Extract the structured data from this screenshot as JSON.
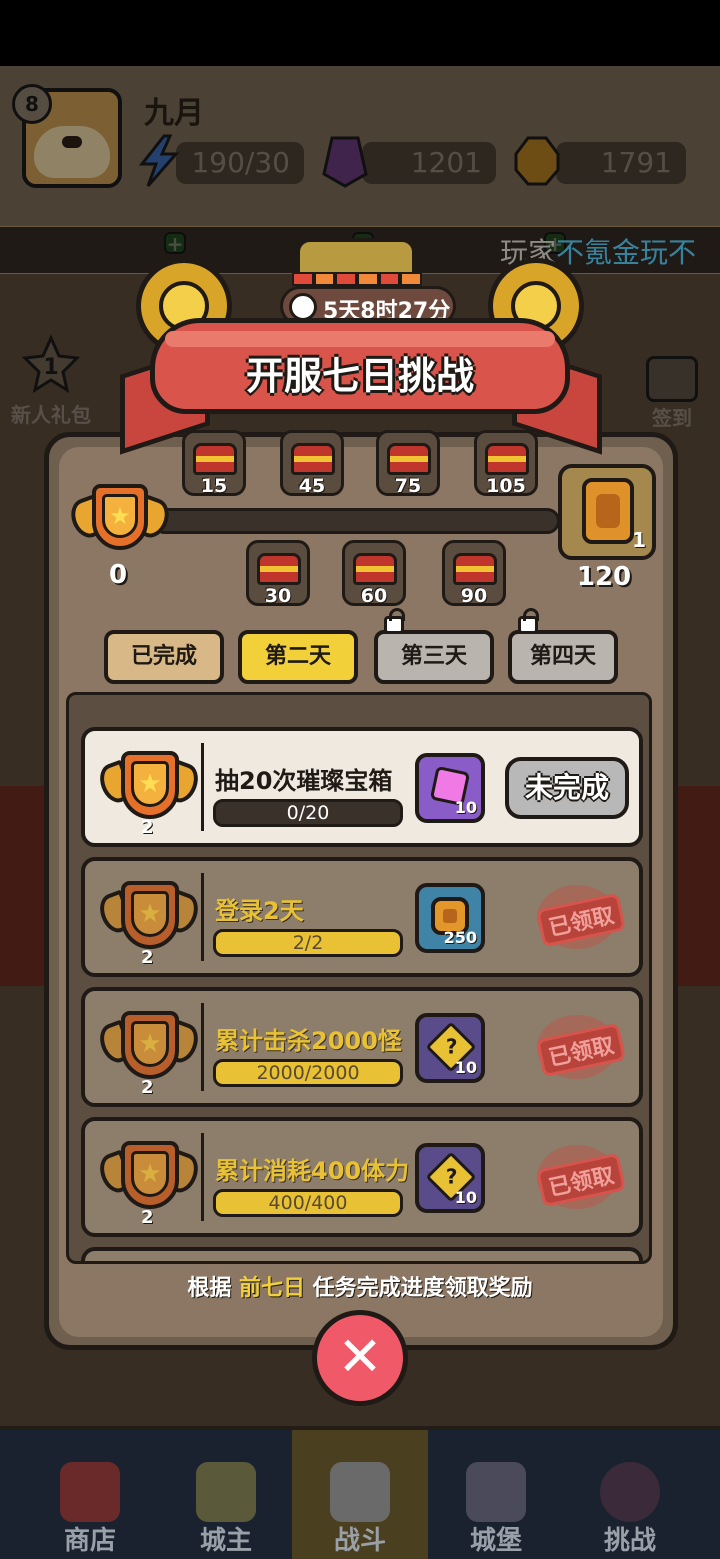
{
  "player": {
    "level": "8",
    "name": "九月"
  },
  "resources": [
    {
      "icon": "lightning-icon",
      "value": "190/30"
    },
    {
      "icon": "purple-gem-icon",
      "value": "1201"
    },
    {
      "icon": "gold-coin-icon",
      "value": "1791"
    }
  ],
  "ticker": {
    "prefix": "玩家",
    "highlight": "不氪金玩不"
  },
  "side_buttons": {
    "newbie_gift": "新人礼包",
    "checkin": "签到"
  },
  "event": {
    "timer": "5天8时27分",
    "title": "开服七日挑战",
    "current_points": "0",
    "progress": 0,
    "milestones_top": [
      "15",
      "45",
      "75",
      "105"
    ],
    "milestones_bottom": [
      "30",
      "60",
      "90"
    ],
    "final_reward": {
      "count": "1",
      "required": "120"
    }
  },
  "tabs": [
    {
      "label": "已完成",
      "state": "done"
    },
    {
      "label": "第二天",
      "state": "active"
    },
    {
      "label": "第三天",
      "state": "locked"
    },
    {
      "label": "第四天",
      "state": "locked"
    }
  ],
  "tasks": [
    {
      "points": "2",
      "title": "抽20次璀璨宝箱",
      "progress": "0/20",
      "progress_fraction": 0,
      "reward_icon": "pink-gem-icon",
      "reward_count": "10",
      "status": "未完成"
    },
    {
      "points": "2",
      "title": "登录2天",
      "progress": "2/2",
      "progress_fraction": 1,
      "reward_icon": "gold-coin-icon",
      "reward_count": "250",
      "status": "已领取"
    },
    {
      "points": "2",
      "title": "累计击杀2000怪",
      "progress": "2000/2000",
      "progress_fraction": 1,
      "reward_icon": "puzzle-piece-icon",
      "reward_count": "10",
      "status": "已领取"
    },
    {
      "points": "2",
      "title": "累计消耗400体力",
      "progress": "400/400",
      "progress_fraction": 1,
      "reward_icon": "puzzle-piece-icon",
      "reward_count": "10",
      "status": "已领取"
    }
  ],
  "hint": {
    "prefix": "根据 ",
    "highlight": "前七日",
    "suffix": " 任务完成进度领取奖励"
  },
  "nav": [
    {
      "label": "商店",
      "icon": "shop-icon"
    },
    {
      "label": "城主",
      "icon": "crown-icon"
    },
    {
      "label": "战斗",
      "icon": "crossed-swords-icon",
      "active": true
    },
    {
      "label": "城堡",
      "icon": "castle-icon"
    },
    {
      "label": "挑战",
      "icon": "demon-icon"
    }
  ]
}
